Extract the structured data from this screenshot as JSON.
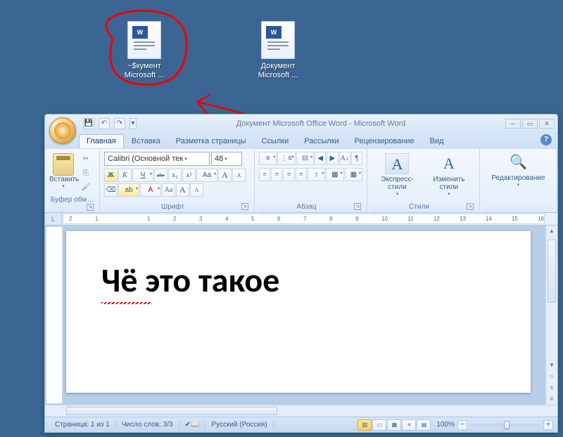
{
  "desktop": {
    "icons": [
      {
        "label": "~$кумент Microsoft ..."
      },
      {
        "label": "Документ Microsoft ..."
      }
    ]
  },
  "window": {
    "title": "Документ Microsoft Office Word - Microsoft Word",
    "qat": {
      "save": "💾",
      "undo": "↶",
      "redo": "↷",
      "more": "▾"
    },
    "winbtns": {
      "min": "─",
      "max": "▭",
      "close": "✕"
    }
  },
  "tabs": {
    "items": [
      "Главная",
      "Вставка",
      "Разметка страницы",
      "Ссылки",
      "Рассылки",
      "Рецензирование",
      "Вид"
    ],
    "active": 0,
    "help": "?"
  },
  "ribbon": {
    "clipboard": {
      "label": "Буфер обм…",
      "paste": "Вставить",
      "cut": "✂",
      "copy": "⎘",
      "fmt": "🖌"
    },
    "font": {
      "label": "Шрифт",
      "name": "Calibri (Основной тек",
      "size": "48",
      "bold": "Ж",
      "italic": "К",
      "underline": "Ч",
      "strike": "abc",
      "sub": "x₂",
      "sup": "x²",
      "case": "Aa",
      "grow": "A",
      "shrink": "A",
      "clear": "⌫",
      "hlcolor": "ab",
      "color": "A"
    },
    "para": {
      "label": "Абзац",
      "bullets": "≡",
      "numbers": "⋮≡",
      "multi": "⊟",
      "dedent": "◀",
      "indent": "▶",
      "sort": "A↓",
      "marks": "¶",
      "alignL": "≡",
      "alignC": "≡",
      "alignR": "≡",
      "alignJ": "≡",
      "spacing": "↕",
      "shade": "▦",
      "border": "▦"
    },
    "styles": {
      "label": "Стили",
      "quick": "Экспресс-стили",
      "change": "Изменить стили"
    },
    "editing": {
      "label": "Редактирование",
      "find": "🔍"
    }
  },
  "ruler": {
    "marks": [
      "2",
      "1",
      "",
      "1",
      "2",
      "3",
      "4",
      "5",
      "6",
      "7",
      "8",
      "9",
      "10",
      "11",
      "12",
      "13",
      "14",
      "15",
      "16"
    ]
  },
  "document": {
    "text": "Чё это такое"
  },
  "status": {
    "page": "Страница: 1 из 1",
    "words": "Число слов: 3/3",
    "lang": "Русский (Россия)",
    "zoom": "100%",
    "zoom_minus": "−",
    "zoom_plus": "+"
  }
}
